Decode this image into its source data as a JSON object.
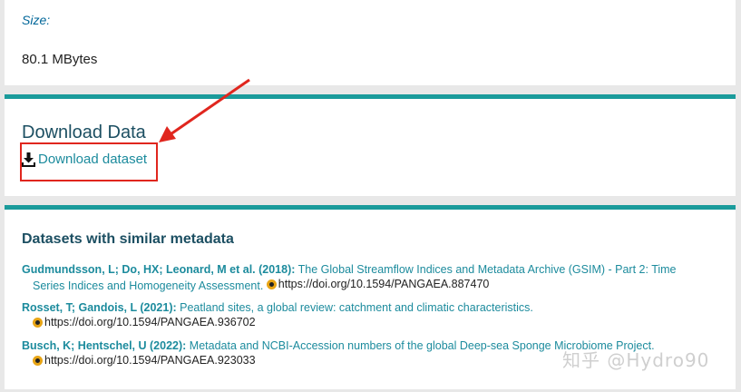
{
  "size": {
    "label": "Size:",
    "value": "80.1 MBytes"
  },
  "download": {
    "title": "Download Data",
    "link_label": "Download dataset"
  },
  "similar": {
    "title": "Datasets with similar metadata",
    "entries": [
      {
        "authors": "Gudmundsson, L; Do, HX; Leonard, M et al. (2018):",
        "title_line1": "The Global Streamflow Indices and Metadata Archive (GSIM) - Part 2: Time",
        "title_line2": "Series Indices and Homogeneity Assessment.",
        "doi": "https://doi.org/10.1594/PANGAEA.887470"
      },
      {
        "authors": "Rosset, T; Gandois, L (2021):",
        "title_line1": "Peatland sites, a global review: catchment and climatic characteristics.",
        "doi": "https://doi.org/10.1594/PANGAEA.936702"
      },
      {
        "authors": "Busch, K; Hentschel, U (2022):",
        "title_line1": "Metadata and NCBI-Accession numbers of the global Deep-sea Sponge Microbiome Project.",
        "doi": "https://doi.org/10.1594/PANGAEA.923033"
      }
    ]
  },
  "watermark": "知乎 @Hydro90",
  "colors": {
    "accent": "#1a9b9b",
    "link": "#1c8b9d",
    "annotation": "#e0261e"
  }
}
